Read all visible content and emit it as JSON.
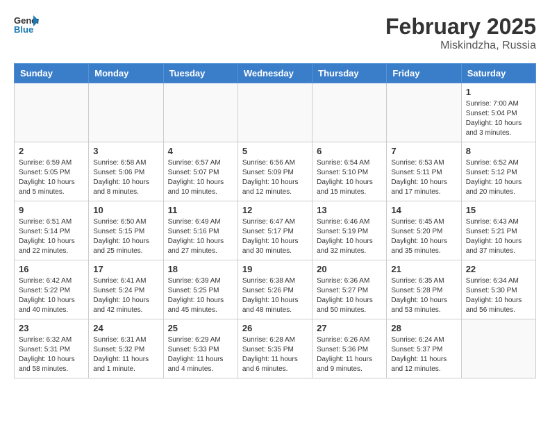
{
  "header": {
    "logo_line1": "General",
    "logo_line2": "Blue",
    "main_title": "February 2025",
    "subtitle": "Miskindzha, Russia"
  },
  "weekdays": [
    "Sunday",
    "Monday",
    "Tuesday",
    "Wednesday",
    "Thursday",
    "Friday",
    "Saturday"
  ],
  "weeks": [
    [
      {
        "day": "",
        "info": ""
      },
      {
        "day": "",
        "info": ""
      },
      {
        "day": "",
        "info": ""
      },
      {
        "day": "",
        "info": ""
      },
      {
        "day": "",
        "info": ""
      },
      {
        "day": "",
        "info": ""
      },
      {
        "day": "1",
        "info": "Sunrise: 7:00 AM\nSunset: 5:04 PM\nDaylight: 10 hours\nand 3 minutes."
      }
    ],
    [
      {
        "day": "2",
        "info": "Sunrise: 6:59 AM\nSunset: 5:05 PM\nDaylight: 10 hours\nand 5 minutes."
      },
      {
        "day": "3",
        "info": "Sunrise: 6:58 AM\nSunset: 5:06 PM\nDaylight: 10 hours\nand 8 minutes."
      },
      {
        "day": "4",
        "info": "Sunrise: 6:57 AM\nSunset: 5:07 PM\nDaylight: 10 hours\nand 10 minutes."
      },
      {
        "day": "5",
        "info": "Sunrise: 6:56 AM\nSunset: 5:09 PM\nDaylight: 10 hours\nand 12 minutes."
      },
      {
        "day": "6",
        "info": "Sunrise: 6:54 AM\nSunset: 5:10 PM\nDaylight: 10 hours\nand 15 minutes."
      },
      {
        "day": "7",
        "info": "Sunrise: 6:53 AM\nSunset: 5:11 PM\nDaylight: 10 hours\nand 17 minutes."
      },
      {
        "day": "8",
        "info": "Sunrise: 6:52 AM\nSunset: 5:12 PM\nDaylight: 10 hours\nand 20 minutes."
      }
    ],
    [
      {
        "day": "9",
        "info": "Sunrise: 6:51 AM\nSunset: 5:14 PM\nDaylight: 10 hours\nand 22 minutes."
      },
      {
        "day": "10",
        "info": "Sunrise: 6:50 AM\nSunset: 5:15 PM\nDaylight: 10 hours\nand 25 minutes."
      },
      {
        "day": "11",
        "info": "Sunrise: 6:49 AM\nSunset: 5:16 PM\nDaylight: 10 hours\nand 27 minutes."
      },
      {
        "day": "12",
        "info": "Sunrise: 6:47 AM\nSunset: 5:17 PM\nDaylight: 10 hours\nand 30 minutes."
      },
      {
        "day": "13",
        "info": "Sunrise: 6:46 AM\nSunset: 5:19 PM\nDaylight: 10 hours\nand 32 minutes."
      },
      {
        "day": "14",
        "info": "Sunrise: 6:45 AM\nSunset: 5:20 PM\nDaylight: 10 hours\nand 35 minutes."
      },
      {
        "day": "15",
        "info": "Sunrise: 6:43 AM\nSunset: 5:21 PM\nDaylight: 10 hours\nand 37 minutes."
      }
    ],
    [
      {
        "day": "16",
        "info": "Sunrise: 6:42 AM\nSunset: 5:22 PM\nDaylight: 10 hours\nand 40 minutes."
      },
      {
        "day": "17",
        "info": "Sunrise: 6:41 AM\nSunset: 5:24 PM\nDaylight: 10 hours\nand 42 minutes."
      },
      {
        "day": "18",
        "info": "Sunrise: 6:39 AM\nSunset: 5:25 PM\nDaylight: 10 hours\nand 45 minutes."
      },
      {
        "day": "19",
        "info": "Sunrise: 6:38 AM\nSunset: 5:26 PM\nDaylight: 10 hours\nand 48 minutes."
      },
      {
        "day": "20",
        "info": "Sunrise: 6:36 AM\nSunset: 5:27 PM\nDaylight: 10 hours\nand 50 minutes."
      },
      {
        "day": "21",
        "info": "Sunrise: 6:35 AM\nSunset: 5:28 PM\nDaylight: 10 hours\nand 53 minutes."
      },
      {
        "day": "22",
        "info": "Sunrise: 6:34 AM\nSunset: 5:30 PM\nDaylight: 10 hours\nand 56 minutes."
      }
    ],
    [
      {
        "day": "23",
        "info": "Sunrise: 6:32 AM\nSunset: 5:31 PM\nDaylight: 10 hours\nand 58 minutes."
      },
      {
        "day": "24",
        "info": "Sunrise: 6:31 AM\nSunset: 5:32 PM\nDaylight: 11 hours\nand 1 minute."
      },
      {
        "day": "25",
        "info": "Sunrise: 6:29 AM\nSunset: 5:33 PM\nDaylight: 11 hours\nand 4 minutes."
      },
      {
        "day": "26",
        "info": "Sunrise: 6:28 AM\nSunset: 5:35 PM\nDaylight: 11 hours\nand 6 minutes."
      },
      {
        "day": "27",
        "info": "Sunrise: 6:26 AM\nSunset: 5:36 PM\nDaylight: 11 hours\nand 9 minutes."
      },
      {
        "day": "28",
        "info": "Sunrise: 6:24 AM\nSunset: 5:37 PM\nDaylight: 11 hours\nand 12 minutes."
      },
      {
        "day": "",
        "info": ""
      }
    ]
  ]
}
